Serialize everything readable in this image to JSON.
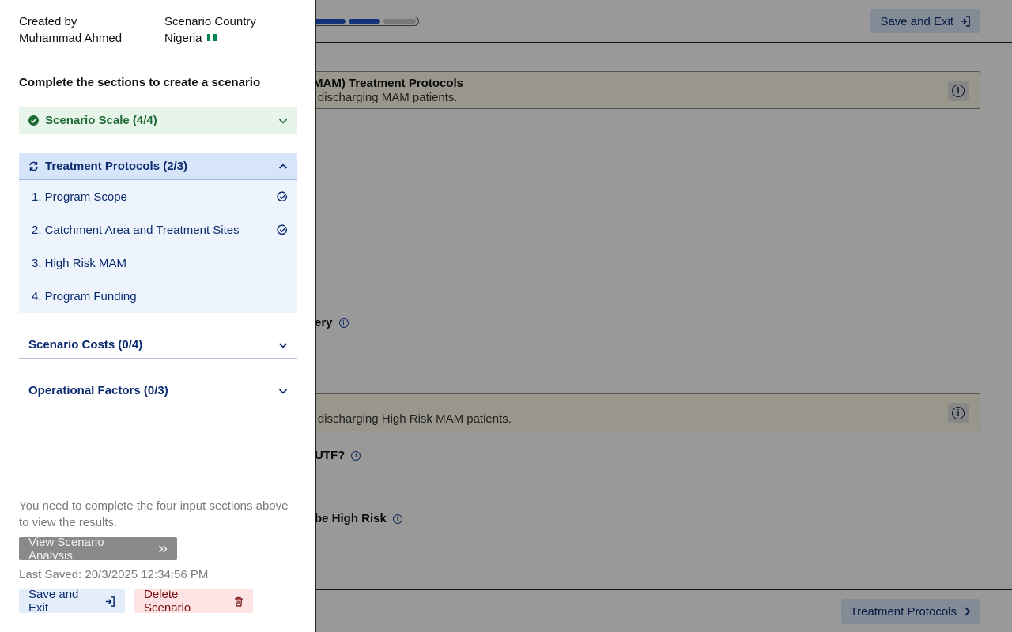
{
  "background": {
    "save_exit_label": "Save and Exit",
    "section1_title": "(MAM) Treatment Protocols",
    "section1_desc": "nd discharging MAM patients.",
    "question_recovery": "ery",
    "section2_desc": "nd discharging High Risk MAM patients.",
    "question_utf": "UTF?",
    "question_high_risk": "be High Risk",
    "next_button_label": "Treatment Protocols"
  },
  "drawer": {
    "created_by_label": "Created by",
    "created_by_value": "Muhammad Ahmed",
    "country_label": "Scenario Country",
    "country_value": "Nigeria",
    "instruction": "Complete the sections to create a scenario",
    "sections": {
      "scale": "Scenario Scale (4/4)",
      "treatment": "Treatment Protocols (2/3)",
      "costs": "Scenario Costs (0/4)",
      "operational": "Operational Factors (0/3)"
    },
    "treatment_items": [
      {
        "label": "1. Program Scope",
        "done": true
      },
      {
        "label": "2. Catchment Area and Treatment Sites",
        "done": true
      },
      {
        "label": "3. High Risk MAM",
        "done": false
      },
      {
        "label": "4. Program Funding",
        "done": false
      }
    ],
    "note": "You need to complete the four input sections above to view the results.",
    "view_analysis_label": "View Scenario Analysis",
    "last_saved": "Last Saved: 20/3/2025 12:34:56 PM",
    "save_exit_label": "Save and Exit",
    "delete_label": "Delete Scenario"
  },
  "colors": {
    "brand_blue": "#0b2b6f",
    "success_green": "#1c6b35",
    "danger_red": "#7a1212",
    "flag_green": "#008751"
  }
}
